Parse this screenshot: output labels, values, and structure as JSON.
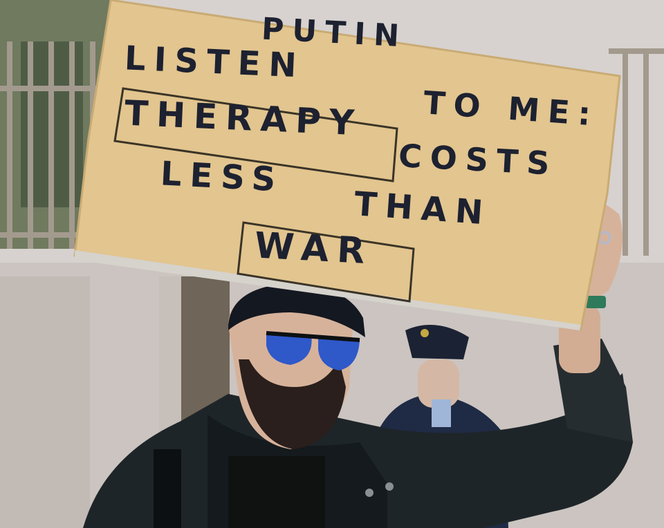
{
  "sign": {
    "line1": "PUTIN",
    "line2": "LISTEN",
    "line3": "TO ME:",
    "line4": "THERAPY",
    "line5": "COSTS",
    "line6": "LESS",
    "line7": "THAN",
    "line8": "WAR"
  },
  "colors": {
    "cardboard": "#e2c58f",
    "marker": "#1d2130",
    "wall": "#cbc4c0",
    "jacket": "#1e2529",
    "lens": "#2f58c9"
  }
}
